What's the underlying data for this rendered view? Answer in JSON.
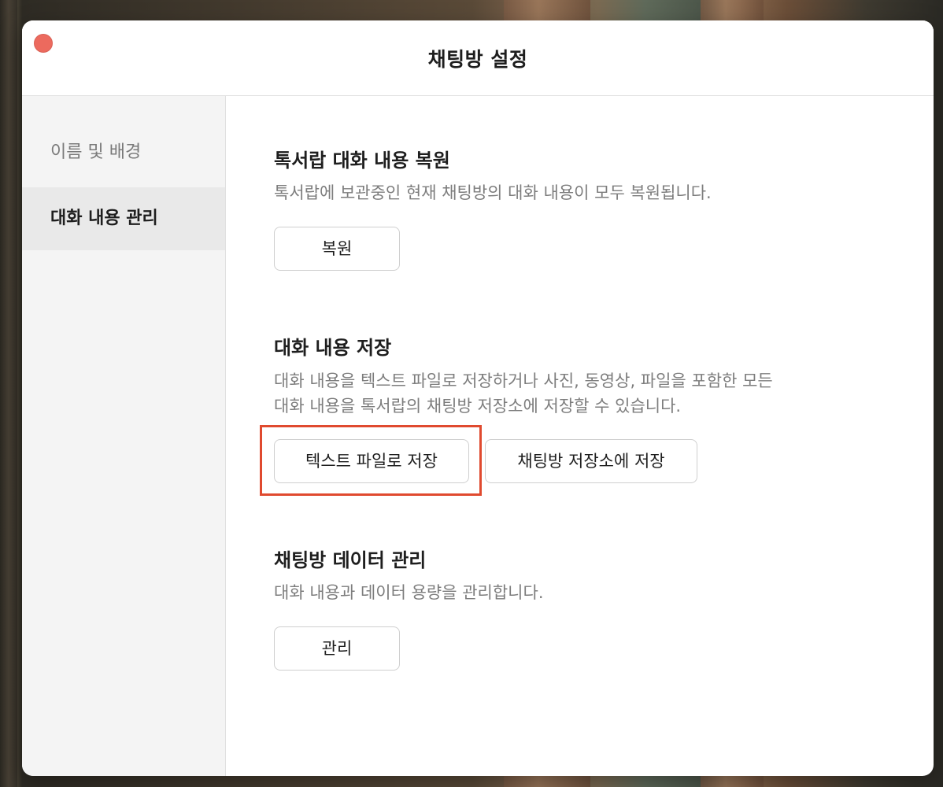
{
  "window": {
    "title": "채팅방 설정"
  },
  "sidebar": {
    "items": [
      {
        "label": "이름 및 배경",
        "active": false
      },
      {
        "label": "대화 내용 관리",
        "active": true
      }
    ]
  },
  "sections": {
    "restore": {
      "title": "톡서랍 대화 내용 복원",
      "description": "톡서랍에 보관중인 현재 채팅방의 대화 내용이 모두 복원됩니다.",
      "button": "복원"
    },
    "save": {
      "title": "대화 내용 저장",
      "description_line1": "대화 내용을 텍스트 파일로 저장하거나 사진, 동영상, 파일을 포함한 모든",
      "description_line2": "대화 내용을 톡서랍의 채팅방 저장소에 저장할 수 있습니다.",
      "button_text_file": "텍스트 파일로 저장",
      "button_storage": "채팅방 저장소에 저장"
    },
    "data": {
      "title": "채팅방 데이터 관리",
      "description": "대화 내용과 데이터 용량을 관리합니다.",
      "button": "관리"
    }
  },
  "colors": {
    "close_button": "#ec6a5e",
    "highlight": "#e04a2f",
    "sidebar_bg": "#f4f4f4",
    "sidebar_active_bg": "#e9e9e9"
  }
}
